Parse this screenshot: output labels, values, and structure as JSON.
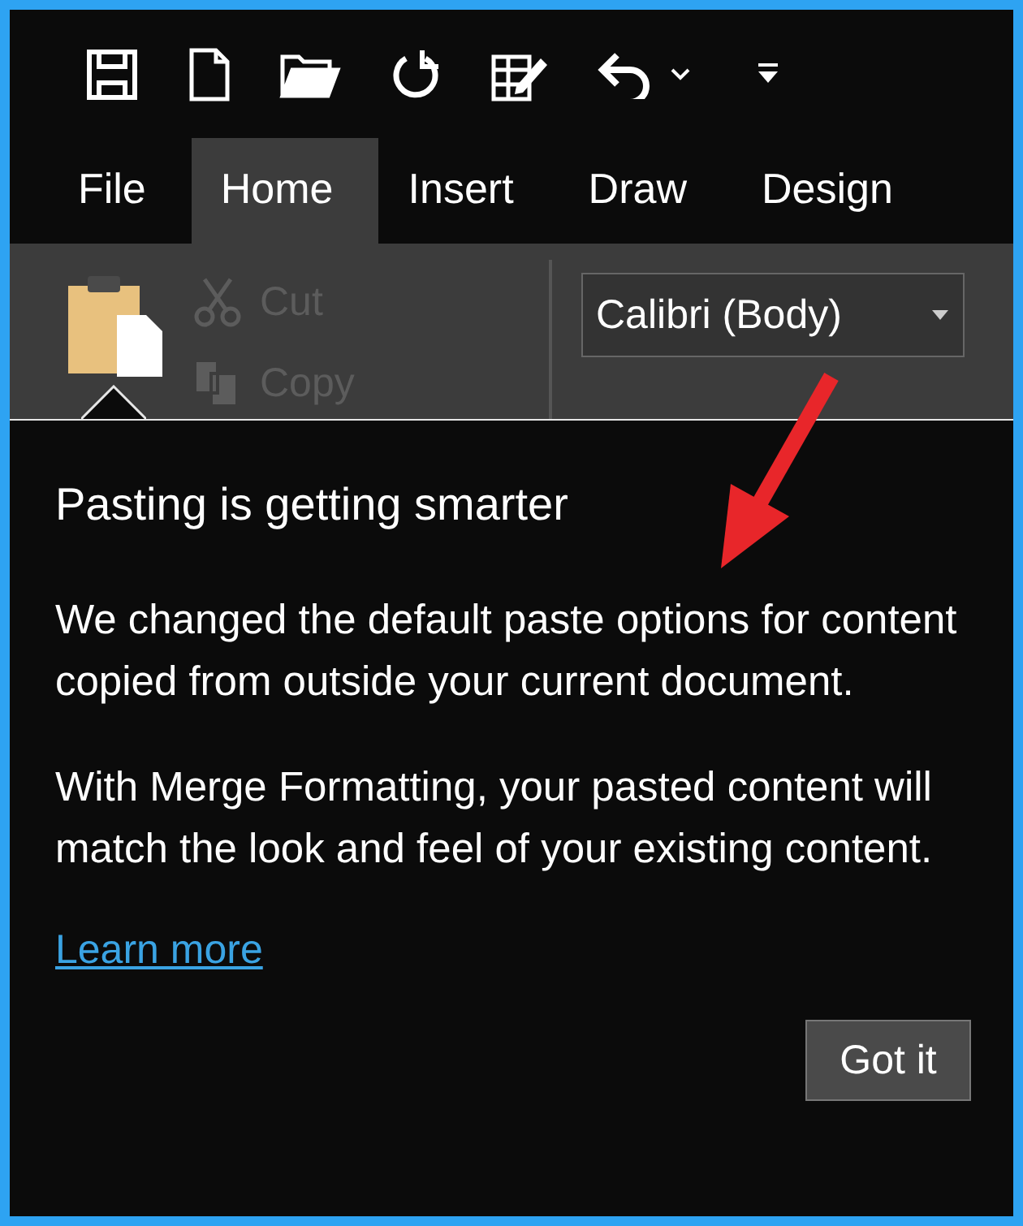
{
  "tabs": [
    {
      "label": "File",
      "selected": false
    },
    {
      "label": "Home",
      "selected": true
    },
    {
      "label": "Insert",
      "selected": false
    },
    {
      "label": "Draw",
      "selected": false
    },
    {
      "label": "Design",
      "selected": false
    }
  ],
  "clipboard": [
    {
      "kind": "cut",
      "label": "Cut",
      "disabled": true
    },
    {
      "kind": "copy",
      "label": "Copy",
      "disabled": true
    }
  ],
  "font_box": {
    "value": "Calibri (Body)"
  },
  "callout": {
    "title": "Pasting is getting smarter",
    "paragraphs": [
      "We changed the default paste options for content copied from outside your current document.",
      "With Merge Formatting, your pasted content will match the look and feel of your existing content."
    ],
    "link": "Learn more",
    "button": "Got it"
  }
}
